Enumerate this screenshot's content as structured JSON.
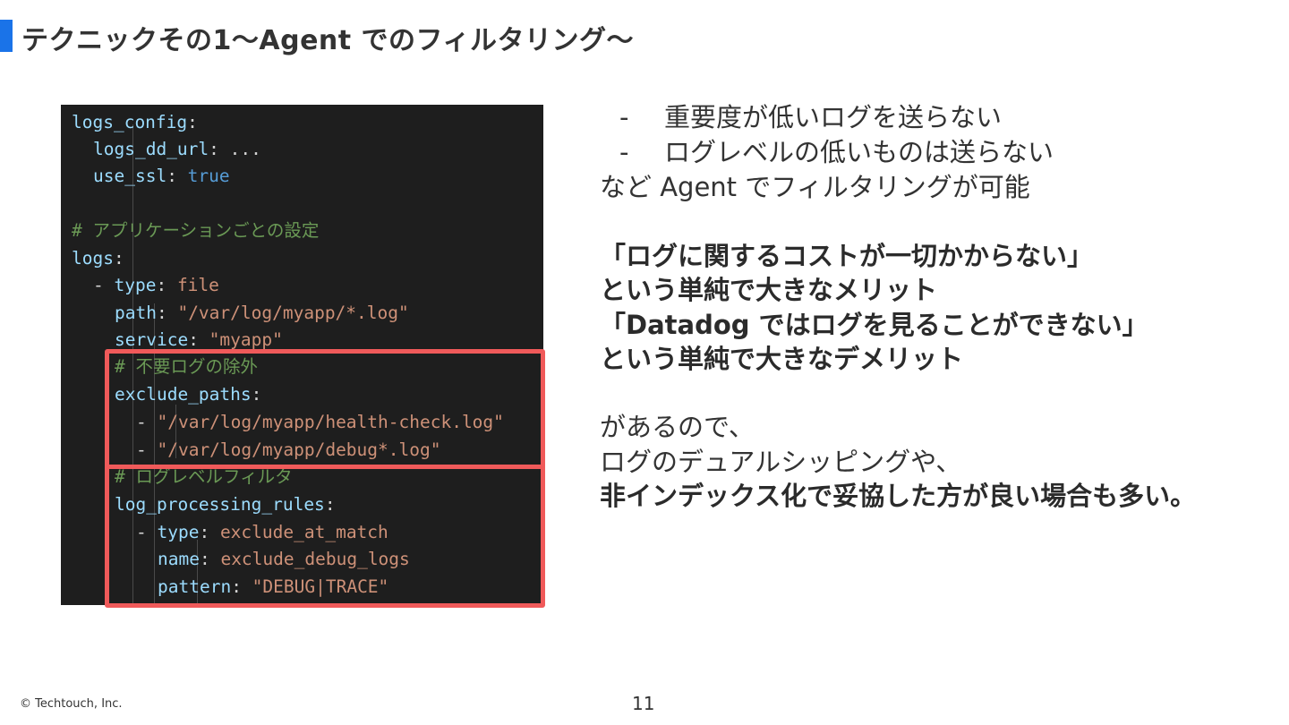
{
  "title": "テクニックその1〜Agent でのフィルタリング〜",
  "colors": {
    "accent": "#1a73e8",
    "highlight_box": "#f05a5a",
    "code_background": "#1e1e1e",
    "code_key": "#9cdcfe",
    "code_string": "#ce9178",
    "code_boolean": "#569cd6",
    "code_comment": "#6a9955"
  },
  "code": {
    "l1": {
      "key": "logs_config",
      "punct": ":"
    },
    "l2": {
      "key": "logs_dd_url",
      "punct": ": ",
      "value": "..."
    },
    "l3": {
      "key": "use_ssl",
      "punct": ": ",
      "value": "true"
    },
    "l4": {
      "comment": "# アプリケーションごとの設定"
    },
    "l5": {
      "key": "logs",
      "punct": ":"
    },
    "l6": {
      "dash": "- ",
      "key": "type",
      "punct": ": ",
      "value": "file"
    },
    "l7": {
      "key": "path",
      "punct": ": ",
      "value": "\"/var/log/myapp/*.log\""
    },
    "l8": {
      "key": "service",
      "punct": ": ",
      "value": "\"myapp\""
    },
    "l9": {
      "comment": "# 不要ログの除外"
    },
    "l10": {
      "key": "exclude_paths",
      "punct": ":"
    },
    "l11": {
      "dash": "- ",
      "value": "\"/var/log/myapp/health-check.log\""
    },
    "l12": {
      "dash": "- ",
      "value": "\"/var/log/myapp/debug*.log\""
    },
    "l13": {
      "comment": "# ログレベルフィルタ"
    },
    "l14": {
      "key": "log_processing_rules",
      "punct": ":"
    },
    "l15": {
      "dash": "- ",
      "key": "type",
      "punct": ": ",
      "value": "exclude_at_match"
    },
    "l16": {
      "key": "name",
      "punct": ": ",
      "value": "exclude_debug_logs"
    },
    "l17": {
      "key": "pattern",
      "punct": ": ",
      "value": "\"DEBUG|TRACE\""
    }
  },
  "bullets": [
    {
      "marker": "-",
      "text": "重要度が低いログを送らない"
    },
    {
      "marker": "-",
      "text": "ログレベルの低いものは送らない"
    }
  ],
  "text": {
    "line1": "など Agent でフィルタリングが可能",
    "bold1": "「ログに関するコストが一切かからない」",
    "bold2": "という単純で大きなメリット",
    "bold3": "「Datadog ではログを見ることができない」",
    "bold4": "という単純で大きなデメリット",
    "line2": "があるので、",
    "line3": "ログのデュアルシッピングや、",
    "bold5": "非インデックス化で妥協した方が良い場合も多い。"
  },
  "footer": {
    "copyright": "© Techtouch, Inc.",
    "page": "11"
  }
}
